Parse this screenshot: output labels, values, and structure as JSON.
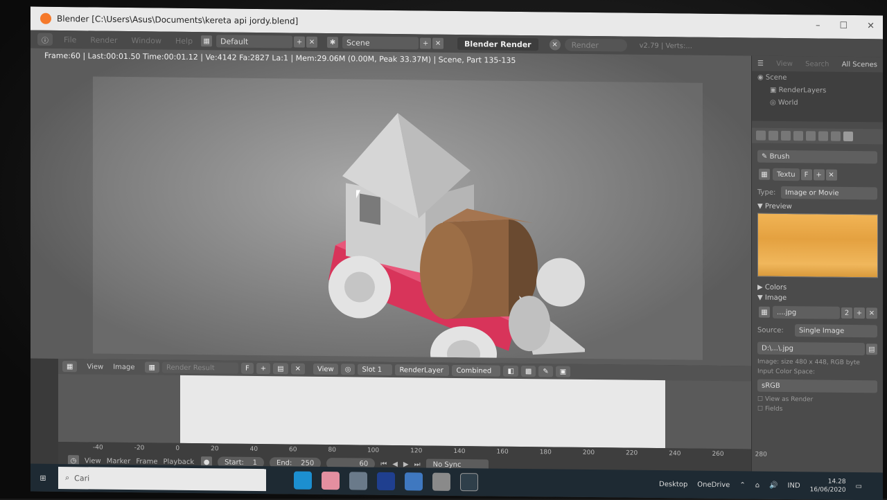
{
  "window": {
    "title": "Blender [C:\\Users\\Asus\\Documents\\kereta api jordy.blend]"
  },
  "menubar": {
    "menus": [
      "File",
      "Render",
      "Window",
      "Help"
    ],
    "layout": "Default",
    "scene": "Scene",
    "engine": "Blender Render",
    "render_field": "Render",
    "version_info": "v2.79 | Verts:..."
  },
  "viewport": {
    "stats": "Frame:60 | Last:00:01.50 Time:00:01.12 | Ve:4142 Fa:2827 La:1 | Mem:29.06M (0.00M, Peak 33.37M) | Scene, Part 135-135"
  },
  "outliner": {
    "menus": [
      "View",
      "Search",
      "All Scenes"
    ],
    "items": [
      "Scene",
      "RenderLayers",
      "World"
    ]
  },
  "properties": {
    "brush": "Brush",
    "texture_name": "Textu",
    "texture_fake": "F",
    "type_label": "Type:",
    "type_value": "Image or Movie",
    "preview_label": "Preview",
    "colors_label": "Colors",
    "image_label": "Image",
    "image_name": "....jpg",
    "image_users": "2",
    "source_label": "Source:",
    "source_value": "Single Image",
    "filepath": "D:\\...\\.jpg",
    "image_size": "Image: size 480 x 448, RGB byte",
    "color_space_label": "Input Color Space:",
    "color_space": "sRGB",
    "view_as_render": "View as Render",
    "fields": "Fields"
  },
  "image_editor": {
    "menus": [
      "View",
      "Image"
    ],
    "image_name": "Render Result",
    "fake": "F",
    "view": "View",
    "slot": "Slot 1",
    "layer": "RenderLayer",
    "pass": "Combined"
  },
  "timeline": {
    "ruler": [
      "-40",
      "-20",
      "0",
      "20",
      "40",
      "60",
      "80",
      "100",
      "120",
      "140",
      "160",
      "180",
      "200",
      "220",
      "240",
      "260",
      "280"
    ],
    "menus": [
      "View",
      "Marker",
      "Frame",
      "Playback"
    ],
    "start": "Start:",
    "start_value": "1",
    "end": "End:",
    "end_value": "250",
    "current": "60",
    "sync": "No Sync"
  },
  "taskbar": {
    "search_placeholder": "Cari",
    "desktop": "Desktop",
    "onedrive": "OneDrive",
    "lang": "IND",
    "time": "14.28",
    "date": "16/06/2020"
  }
}
